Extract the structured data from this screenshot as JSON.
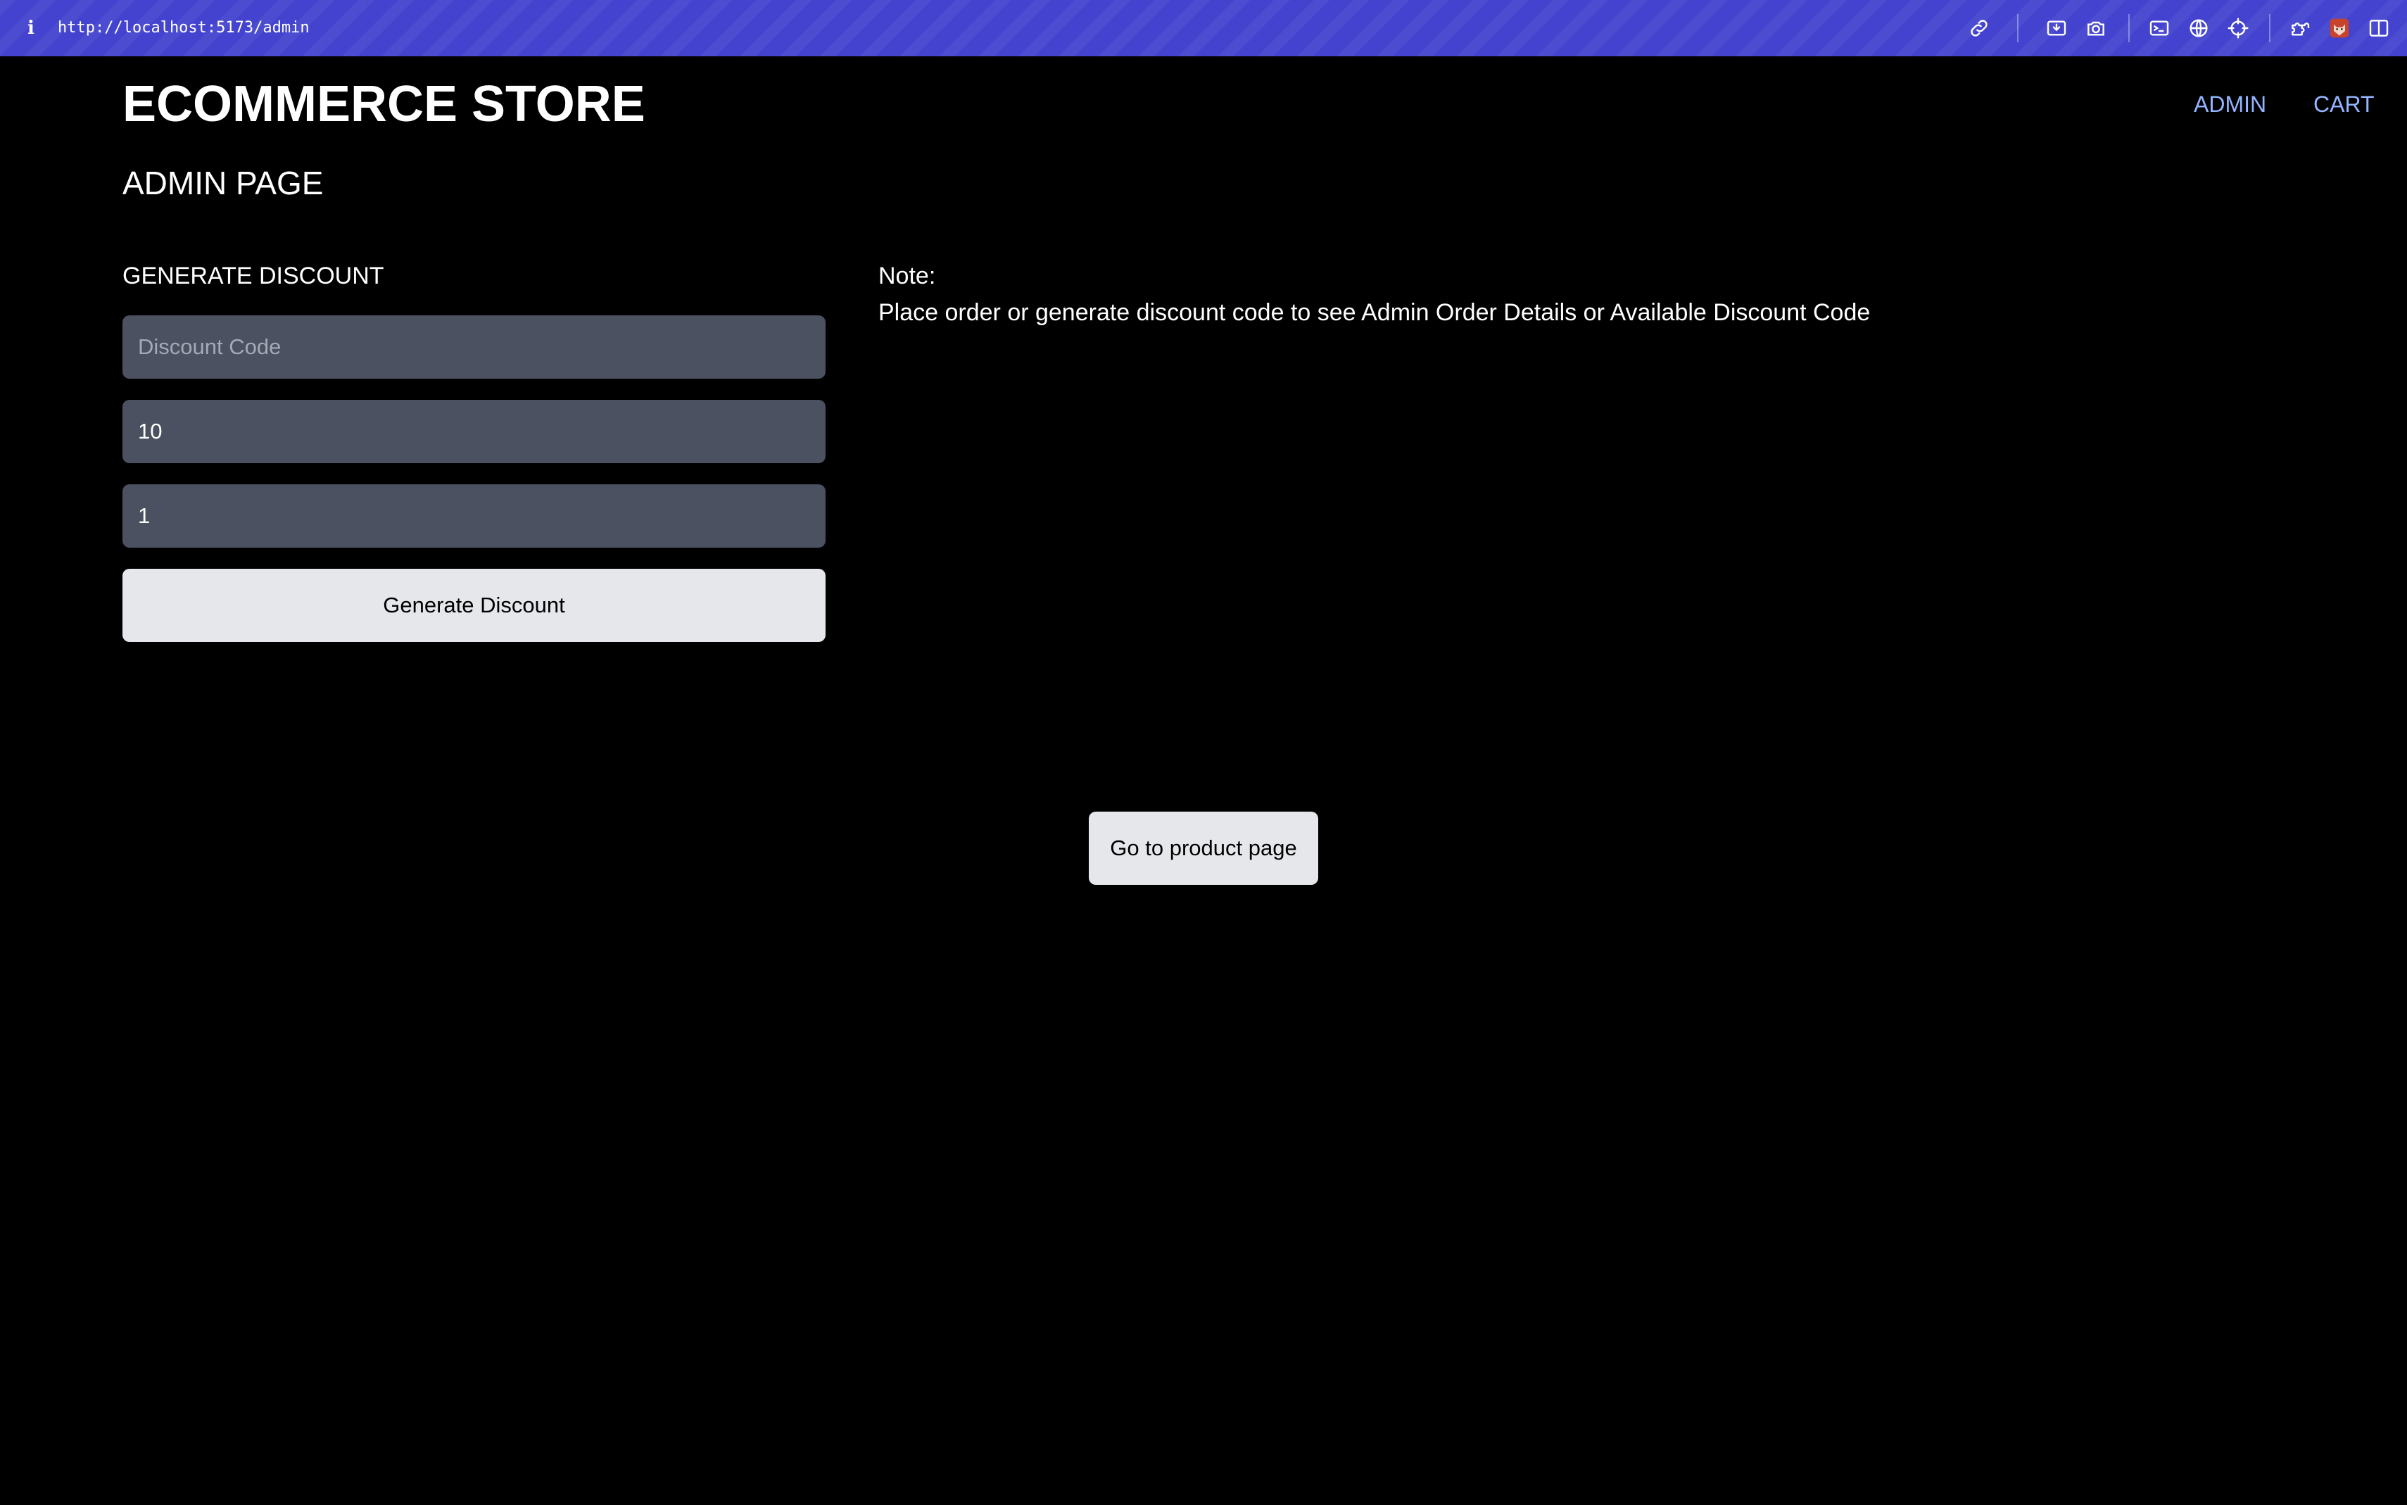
{
  "browser": {
    "url": "http://localhost:5173/admin",
    "info_glyph": "i",
    "toolbar_icons": [
      "link-icon",
      "download-icon",
      "camera-icon",
      "terminal-icon",
      "globe-icon",
      "crosshair-icon",
      "extensions-icon",
      "fox-avatar-icon",
      "sidebar-toggle-icon"
    ]
  },
  "header": {
    "store_title": "ECOMMERCE STORE",
    "nav": {
      "admin": "ADMIN",
      "cart": "CART"
    },
    "link_color": "#93b4ff"
  },
  "page": {
    "title": "ADMIN PAGE"
  },
  "discount_form": {
    "section_title": "GENERATE DISCOUNT",
    "code_placeholder": "Discount Code",
    "code_value": "",
    "percent_value": "10",
    "count_value": "1",
    "submit_label": "Generate Discount"
  },
  "note": {
    "label": "Note:",
    "text": "Place order or generate discount code to see Admin Order Details or Available Discount Code"
  },
  "footer": {
    "product_page_label": "Go to product page"
  },
  "colors": {
    "browser_bar": "#4343cf",
    "background": "#000000",
    "input_bg": "#4b5160",
    "button_bg": "#e5e7eb"
  }
}
